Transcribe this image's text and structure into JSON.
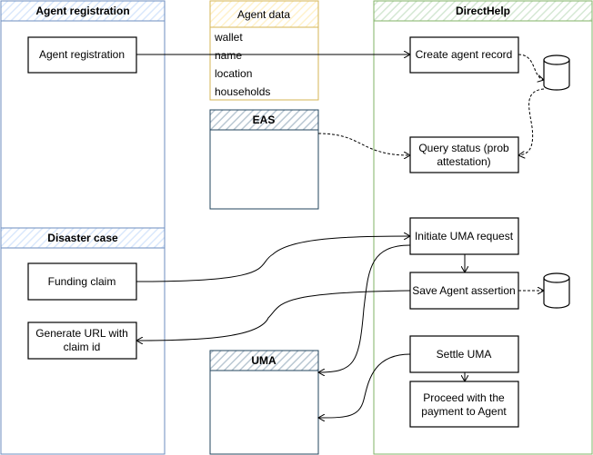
{
  "colors": {
    "blue": "#6c8ebf",
    "blue_fill": "#dae8fc",
    "yellow": "#d6b656",
    "yellow_fill": "#fff2cc",
    "green": "#82b366",
    "green_fill": "#d5e8d4",
    "slate": "#23445d",
    "slate_fill": "#bac8d3"
  },
  "containers": {
    "agent_registration": {
      "title": "Agent registration"
    },
    "agent_data": {
      "title": "Agent data",
      "fields": [
        "wallet",
        "name",
        "location",
        "households"
      ]
    },
    "eas": {
      "title": "EAS"
    },
    "directhelp": {
      "title": "DirectHelp"
    },
    "disaster_case": {
      "title": "Disaster case"
    },
    "uma": {
      "title": "UMA"
    }
  },
  "nodes": {
    "agent_registration": "Agent registration",
    "create_agent_record": "Create agent record",
    "query_status": [
      "Query status (prob",
      "attestation)"
    ],
    "initiate_uma": "Initiate UMA request",
    "save_assertion": "Save Agent assertion",
    "settle_uma": "Settle UMA",
    "proceed_payment": [
      "Proceed with the",
      "payment to Agent"
    ],
    "funding_claim": "Funding claim",
    "generate_url": [
      "Generate URL with",
      "claim id"
    ]
  },
  "icons": {
    "database": "cylinder-icon"
  }
}
